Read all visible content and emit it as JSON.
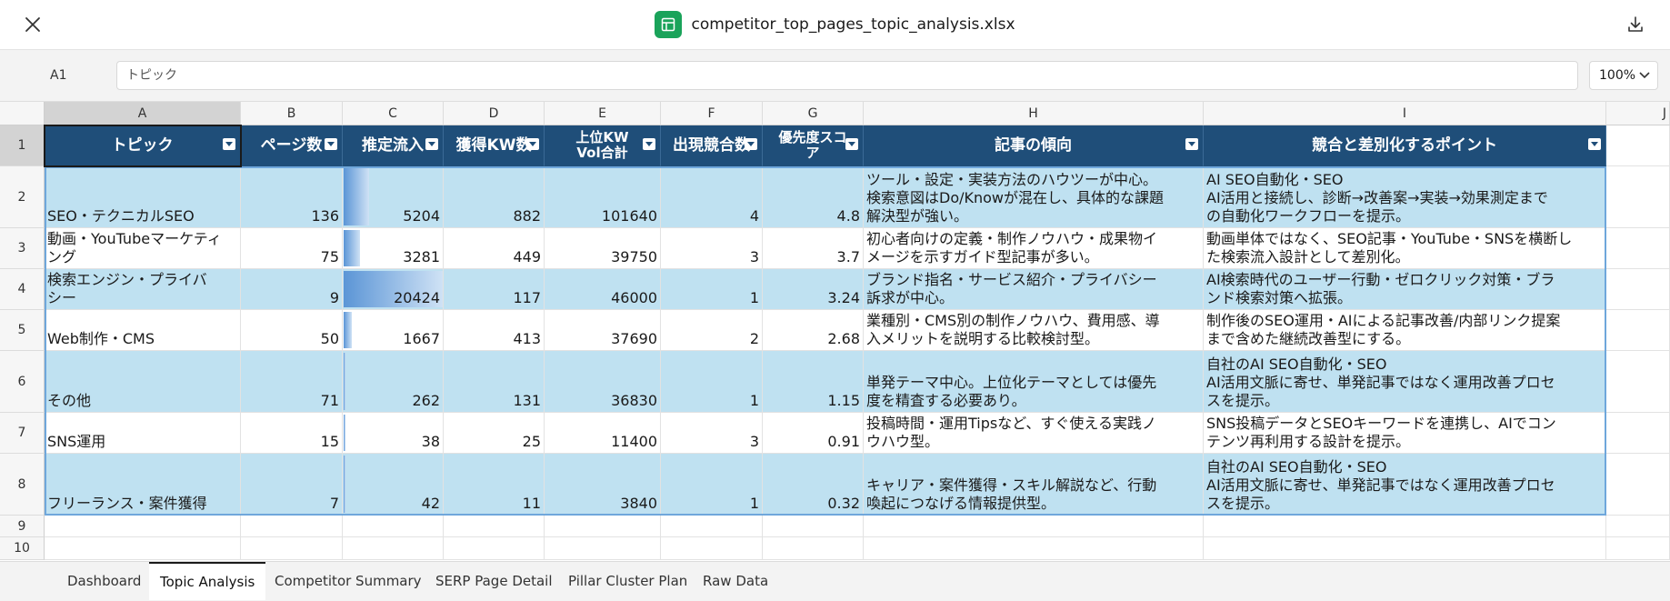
{
  "window": {
    "file_name": "competitor_top_pages_topic_analysis.xlsx",
    "close_icon": "close-icon",
    "download_icon": "download-icon",
    "file_icon": "spreadsheet-icon",
    "accent_color": "#1aa35a"
  },
  "formula_bar": {
    "cell_ref": "A1",
    "value": "トピック",
    "zoom": "100%"
  },
  "columns": [
    "A",
    "B",
    "C",
    "D",
    "E",
    "F",
    "G",
    "H",
    "I",
    "J"
  ],
  "row_numbers": [
    "1",
    "2",
    "3",
    "4",
    "5",
    "6",
    "7",
    "8",
    "9",
    "10"
  ],
  "table": {
    "header_color": "#1f4e79",
    "band_color": "#bfe1f1",
    "headers": [
      "トピック",
      "ページ数",
      "推定流入",
      "獲得KW数",
      "上位KW Vol合計",
      "出現競合数",
      "優先度スコア",
      "記事の傾向",
      "競合と差別化するポイント"
    ],
    "header_lines": {
      "e": [
        "上位KW",
        "Vol合計"
      ],
      "g": [
        "優先度スコ",
        "ア"
      ]
    },
    "rows": [
      {
        "topic": "SEO・テクニカルSEO",
        "pages": "136",
        "traffic": "5204",
        "kw": "882",
        "vol": "101640",
        "competitors": "4",
        "score": "4.8",
        "trend": [
          "ツール・設定・実装方法のハウツーが中心。",
          "検索意図はDo/Knowが混在し、具体的な課題",
          "解決型が強い。"
        ],
        "diff": [
          "AI SEO自動化・SEO",
          "AI活用と接続し、診断→改善案→実装→効果測定まで",
          "の自動化ワークフローを提示。"
        ],
        "traffic_ratio": 0.255
      },
      {
        "topic": "動画・YouTubeマーケティング",
        "topic_lines": [
          "動画・YouTubeマーケティ",
          "ング"
        ],
        "pages": "75",
        "traffic": "3281",
        "kw": "449",
        "vol": "39750",
        "competitors": "3",
        "score": "3.7",
        "trend": [
          "初心者向けの定義・制作ノウハウ・成果物イ",
          "メージを示すガイド型記事が多い。"
        ],
        "diff": [
          "動画単体ではなく、SEO記事・YouTube・SNSを横断し",
          "た検索流入設計として差別化。"
        ],
        "traffic_ratio": 0.161
      },
      {
        "topic": "検索エンジン・プライバシー",
        "topic_lines": [
          "検索エンジン・プライバ",
          "シー"
        ],
        "pages": "9",
        "traffic": "20424",
        "kw": "117",
        "vol": "46000",
        "competitors": "1",
        "score": "3.24",
        "trend": [
          "ブランド指名・サービス紹介・プライバシー",
          "訴求が中心。"
        ],
        "diff": [
          "AI検索時代のユーザー行動・ゼロクリック対策・ブラ",
          "ンド検索対策へ拡張。"
        ],
        "traffic_ratio": 1.0
      },
      {
        "topic": "Web制作・CMS",
        "pages": "50",
        "traffic": "1667",
        "kw": "413",
        "vol": "37690",
        "competitors": "2",
        "score": "2.68",
        "trend": [
          "業種別・CMS別の制作ノウハウ、費用感、導",
          "入メリットを説明する比較検討型。"
        ],
        "diff": [
          "制作後のSEO運用・AIによる記事改善/内部リンク提案",
          "まで含めた継続改善型にする。"
        ],
        "traffic_ratio": 0.082
      },
      {
        "topic": "その他",
        "pages": "71",
        "traffic": "262",
        "kw": "131",
        "vol": "36830",
        "competitors": "1",
        "score": "1.15",
        "trend": [
          "単発テーマ中心。上位化テーマとしては優先",
          "度を精査する必要あり。"
        ],
        "diff": [
          "自社のAI SEO自動化・SEO",
          "AI活用文脈に寄せ、単発記事ではなく運用改善プロセ",
          "スを提示。"
        ],
        "traffic_ratio": 0.013
      },
      {
        "topic": "SNS運用",
        "pages": "15",
        "traffic": "38",
        "kw": "25",
        "vol": "11400",
        "competitors": "3",
        "score": "0.91",
        "trend": [
          "投稿時間・運用Tipsなど、すぐ使える実践ノ",
          "ウハウ型。"
        ],
        "diff": [
          "SNS投稿データとSEOキーワードを連携し、AIでコン",
          "テンツ再利用する設計を提示。"
        ],
        "traffic_ratio": 0.002
      },
      {
        "topic": "フリーランス・案件獲得",
        "pages": "7",
        "traffic": "42",
        "kw": "11",
        "vol": "3840",
        "competitors": "1",
        "score": "0.32",
        "trend": [
          "キャリア・案件獲得・スキル解説など、行動",
          "喚起につなげる情報提供型。"
        ],
        "diff": [
          "自社のAI SEO自動化・SEO",
          "AI活用文脈に寄せ、単発記事ではなく運用改善プロセ",
          "スを提示。"
        ],
        "traffic_ratio": 0.002
      }
    ]
  },
  "sheet_tabs": [
    "Dashboard",
    "Topic Analysis",
    "Competitor Summary",
    "SERP Page Detail",
    "Pillar Cluster Plan",
    "Raw Data"
  ],
  "active_tab": "Topic Analysis"
}
